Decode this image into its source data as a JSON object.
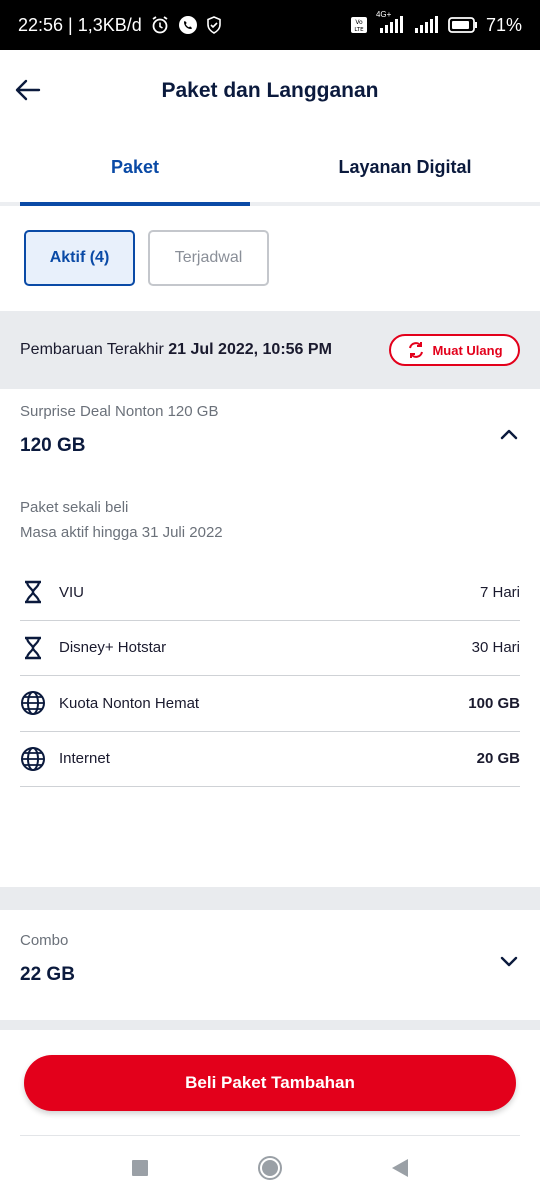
{
  "status_bar": {
    "time_speed": "22:56 | 1,3KB/d",
    "network": "4G+",
    "battery": "71%",
    "icons": [
      "alarm-icon",
      "call-icon",
      "shield-icon",
      "volte-icon",
      "signal-icon",
      "signal-icon",
      "battery-icon"
    ]
  },
  "appbar": {
    "title": "Paket dan Langganan",
    "back_icon": "arrow-left-icon"
  },
  "tabs": [
    {
      "label": "Paket",
      "active": true
    },
    {
      "label": "Layanan Digital",
      "active": false
    }
  ],
  "filters": [
    {
      "label": "Aktif (4)",
      "active": true
    },
    {
      "label": "Terjadwal",
      "active": false
    }
  ],
  "update": {
    "prefix": "Pembaruan Terakhir",
    "datetime": "21 Jul 2022, 10:56 PM",
    "reload_label": "Muat Ulang"
  },
  "package": {
    "name": "Surprise Deal Nonton 120 GB",
    "size": "120 GB",
    "note1": "Paket sekali beli",
    "note2": "Masa aktif hingga 31 Juli 2022",
    "expanded": true,
    "benefits": [
      {
        "icon": "hourglass-icon",
        "name": "VIU",
        "value": "7 Hari",
        "bold": false
      },
      {
        "icon": "hourglass-icon",
        "name": "Disney+ Hotstar",
        "value": "30 Hari",
        "bold": false
      },
      {
        "icon": "globe-icon",
        "name": "Kuota Nonton Hemat",
        "value": "100 GB",
        "bold": true
      },
      {
        "icon": "globe-icon",
        "name": "Internet",
        "value": "20 GB",
        "bold": true
      }
    ]
  },
  "combo": {
    "name": "Combo",
    "size": "22 GB",
    "expanded": false
  },
  "cta": {
    "label": "Beli Paket Tambahan"
  },
  "colors": {
    "primary_blue": "#0a4aa6",
    "brand_red": "#e3001b",
    "navy": "#0b1a3d",
    "muted": "#6b717a",
    "section_bg": "#e9ebee"
  }
}
